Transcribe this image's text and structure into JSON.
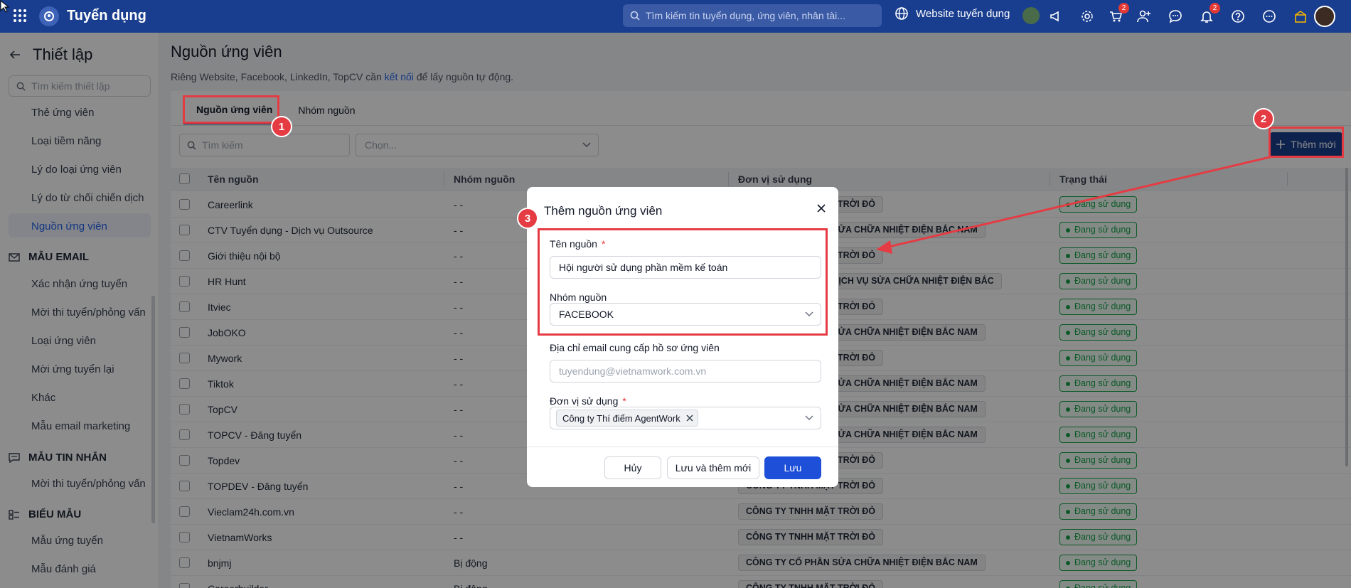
{
  "topbar": {
    "app_title": "Tuyển dụng",
    "search_placeholder": "Tìm kiếm tin tuyển dụng, ứng viên, nhân tài...",
    "website_label": "Website tuyển dụng",
    "cart_badge": "2",
    "bell_badge": "2"
  },
  "sidebar": {
    "title": "Thiết lập",
    "search_placeholder": "Tìm kiếm thiết lập",
    "items_top": [
      "Thẻ ứng viên",
      "Loại tiềm năng",
      "Lý do loại ứng viên",
      "Lý do từ chối chiến dịch",
      "Nguồn ứng viên"
    ],
    "section_email": "MẪU EMAIL",
    "items_email": [
      "Xác nhận ứng tuyển",
      "Mời thi tuyển/phỏng vấn",
      "Loại ứng viên",
      "Mời ứng tuyển lại",
      "Khác",
      "Mẫu email marketing"
    ],
    "section_sms": "MẪU TIN NHẮN",
    "items_sms": [
      "Mời thi tuyển/phỏng vấn"
    ],
    "section_form": "BIỂU MẪU",
    "items_form": [
      "Mẫu ứng tuyển",
      "Mẫu đánh giá"
    ]
  },
  "main": {
    "title": "Nguồn ứng viên",
    "note_before": "Riêng Website, Facebook, LinkedIn, TopCV cần",
    "note_link": "kết nối",
    "note_after": "để lấy nguồn tự động.",
    "tabs": [
      "Nguồn ứng viên",
      "Nhóm nguồn"
    ],
    "search_placeholder": "Tìm kiếm",
    "select_placeholder": "Chọn...",
    "add_button": "Thêm mới",
    "columns": [
      "Tên nguồn",
      "Nhóm nguồn",
      "Đơn vị sử dụng",
      "Trạng thái"
    ],
    "rows": [
      {
        "name": "Careerlink",
        "group": "- -",
        "unit": "CÔNG TY TNHH MẶT TRỜI ĐỎ",
        "status": "Đang sử dụng"
      },
      {
        "name": "CTV Tuyển dụng - Dịch vụ Outsource",
        "group": "- -",
        "unit": "CÔNG TY CỔ PHẦN SỬA CHỮA NHIỆT ĐIỆN BẮC NAM",
        "status": "Đang sử dụng"
      },
      {
        "name": "Giới thiệu nội bộ",
        "group": "- -",
        "unit": "CÔNG TY TNHH MẶT TRỜI ĐỎ",
        "status": "Đang sử dụng"
      },
      {
        "name": "HR Hunt",
        "group": "- -",
        "unit": "CÔNG TY CỔ PHẦN DỊCH VỤ SỬA CHỮA NHIỆT ĐIỆN BẮC",
        "status": "Đang sử dụng"
      },
      {
        "name": "Itviec",
        "group": "- -",
        "unit": "CÔNG TY TNHH MẶT TRỜI ĐỎ",
        "status": "Đang sử dụng"
      },
      {
        "name": "JobOKO",
        "group": "- -",
        "unit": "CÔNG TY CỔ PHẦN SỬA CHỮA NHIỆT ĐIỆN BẮC NAM",
        "status": "Đang sử dụng"
      },
      {
        "name": "Mywork",
        "group": "- -",
        "unit": "CÔNG TY TNHH MẶT TRỜI ĐỎ",
        "status": "Đang sử dụng"
      },
      {
        "name": "Tiktok",
        "group": "- -",
        "unit": "CÔNG TY CỔ PHẦN SỬA CHỮA NHIỆT ĐIỆN BẮC NAM",
        "status": "Đang sử dụng"
      },
      {
        "name": "TopCV",
        "group": "- -",
        "unit": "CÔNG TY CỔ PHẦN SỬA CHỮA NHIỆT ĐIỆN BẮC NAM",
        "status": "Đang sử dụng"
      },
      {
        "name": "TOPCV - Đăng tuyển",
        "group": "- -",
        "unit": "CÔNG TY CỔ PHẦN SỬA CHỮA NHIỆT ĐIỆN BẮC NAM",
        "status": "Đang sử dụng"
      },
      {
        "name": "Topdev",
        "group": "- -",
        "unit": "CÔNG TY TNHH MẶT TRỜI ĐỎ",
        "status": "Đang sử dụng"
      },
      {
        "name": "TOPDEV - Đăng tuyển",
        "group": "- -",
        "unit": "CÔNG TY TNHH MẶT TRỜI ĐỎ",
        "status": "Đang sử dụng"
      },
      {
        "name": "Vieclam24h.com.vn",
        "group": "- -",
        "unit": "CÔNG TY TNHH MẶT TRỜI ĐỎ",
        "status": "Đang sử dụng"
      },
      {
        "name": "VietnamWorks",
        "group": "- -",
        "unit": "CÔNG TY TNHH MẶT TRỜI ĐỎ",
        "status": "Đang sử dụng"
      },
      {
        "name": "bnjmj",
        "group": "Bị động",
        "unit": "CÔNG TY CỔ PHẦN SỬA CHỮA NHIỆT ĐIỆN BẮC NAM",
        "status": "Đang sử dụng"
      },
      {
        "name": "Careerbuilder",
        "group": "Bị động",
        "unit": "CÔNG TY TNHH MẶT TRỜI ĐỎ",
        "status": "Đang sử dụng"
      }
    ]
  },
  "modal": {
    "title": "Thêm nguồn ứng viên",
    "source_name_label": "Tên nguồn",
    "source_name_value": "Hội người sử dụng phần mềm kế toán",
    "group_label": "Nhóm nguồn",
    "group_value": "FACEBOOK",
    "email_label": "Địa chỉ email cung cấp hồ sơ ứng viên",
    "email_placeholder": "tuyendung@vietnamwork.com.vn",
    "unit_label": "Đơn vị sử dụng",
    "unit_chip": "Công ty Thí điểm AgentWork",
    "required_mark": "*",
    "cancel": "Hủy",
    "save_and_new": "Lưu và thêm mới",
    "save": "Lưu"
  },
  "annotations": {
    "step1": "1",
    "step2": "2",
    "step3": "3",
    "color": "#e53b43"
  }
}
